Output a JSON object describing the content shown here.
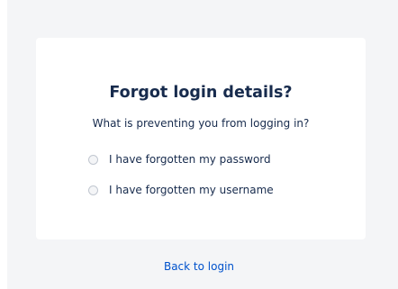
{
  "card": {
    "title": "Forgot login details?",
    "prompt": "What is preventing you from logging in?",
    "options": [
      {
        "label": "I have forgotten my password",
        "selected": false
      },
      {
        "label": "I have forgotten my username",
        "selected": false
      }
    ]
  },
  "footer": {
    "back_link": "Back to login"
  },
  "colors": {
    "background": "#f4f5f7",
    "card": "#ffffff",
    "text": "#172b4d",
    "link": "#0052cc",
    "radio_border": "#c1c7d0"
  }
}
